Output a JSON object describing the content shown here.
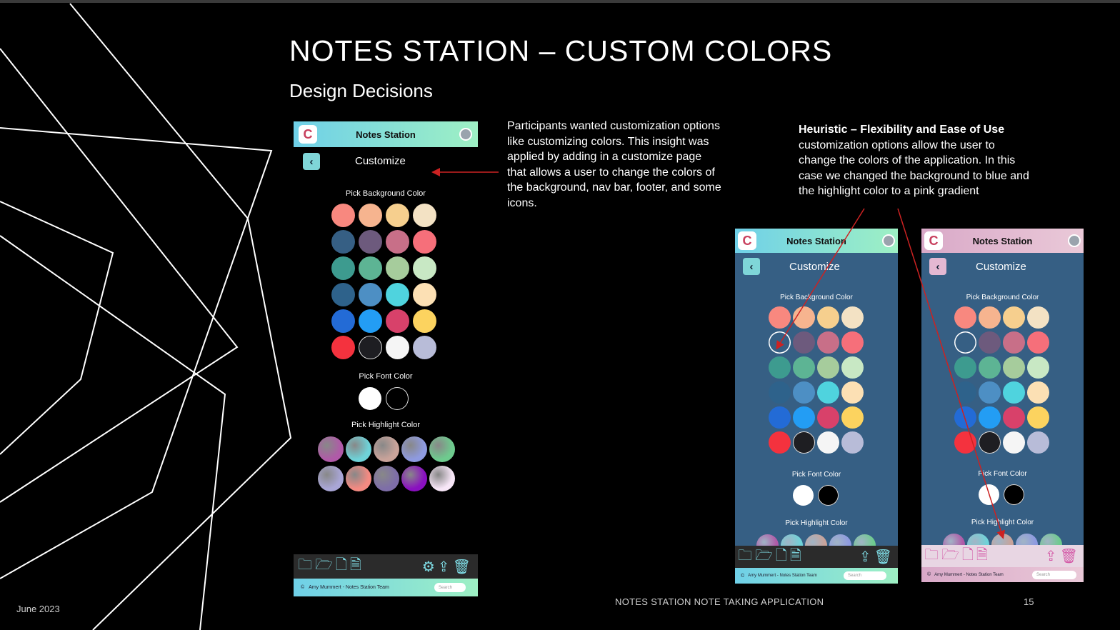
{
  "slide": {
    "title": "NOTES STATION – CUSTOM COLORS",
    "subtitle": "Design Decisions",
    "body": "Participants wanted customization options like customizing colors. This insight was applied by adding in a customize page that allows a user to change the colors of the background, nav bar, footer, and some icons.",
    "heuristic_title": "Heuristic – Flexibility and Ease of Use",
    "heuristic_body": "customization options allow the user to change the colors of the application.  In this case we changed the background to blue and the highlight color to a pink gradient",
    "footer_date": "June 2023",
    "footer_center": "NOTES STATION NOTE TAKING APPLICATION",
    "page_number": "15"
  },
  "app": {
    "name": "Notes Station",
    "logo_glyph": "C",
    "page_title": "Customize",
    "back_glyph": "‹",
    "bg_label": "Pick Background Color",
    "font_label": "Pick Font Color",
    "highlight_label": "Pick Highlight Color",
    "footer_text": "Amy Mummert - Notes Station Team",
    "search_placeholder": "Search",
    "icons": [
      "add-folder-icon",
      "folder-icon",
      "add-file-icon",
      "document-icon",
      "settings-icon",
      "share-icon",
      "trash-icon"
    ]
  },
  "palettes": {
    "background": [
      "#f8887f",
      "#f6b48f",
      "#f6cf8e",
      "#f3e2c4",
      "#365f84",
      "#6d5a7d",
      "#c86f88",
      "#f66f7a",
      "#3d9b8f",
      "#5db494",
      "#a6cc9c",
      "#c8e8c4",
      "#2e628b",
      "#4d8fc4",
      "#4fd3de",
      "#fce0b4",
      "#236bd6",
      "#239df4",
      "#d8416a",
      "#fcd35f",
      "#f4323e",
      "#1e1e22",
      "#f5f5f5",
      "#b8bcd8"
    ],
    "font": [
      "#ffffff",
      "#000000"
    ],
    "highlight": [
      "#b05aa8",
      "#6fd2d8",
      "#c9a39a",
      "#8e9ae0",
      "#6ecb8e",
      "#a9a6d6",
      "#f48a82",
      "#7e6ea8",
      "#8a10c0",
      "#f7e6f7"
    ]
  },
  "colors": {
    "nav_gradient": [
      "#6fd0e8",
      "#9ef0c4"
    ],
    "pink_gradient": [
      "#d9a9c8",
      "#eac9d8"
    ],
    "blue_bg": "#365f84",
    "selected_outline": "#ffffff",
    "arrow": "#cc2222"
  }
}
